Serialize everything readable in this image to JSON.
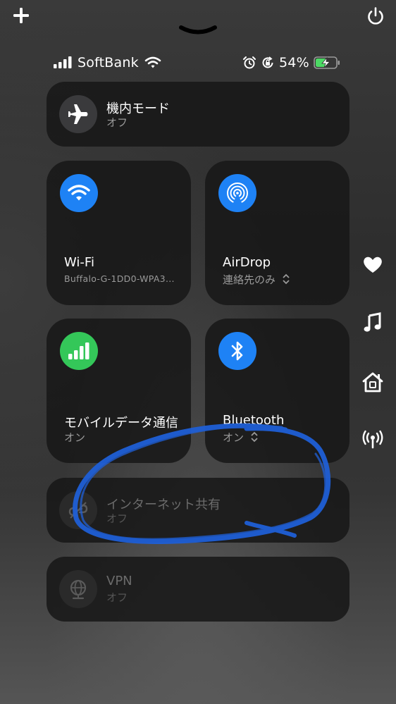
{
  "status_bar": {
    "carrier": "SoftBank",
    "battery_percent": "54%",
    "battery_level": 0.54
  },
  "tiles": {
    "airplane": {
      "title": "機内モード",
      "subtitle": "オフ"
    },
    "wifi": {
      "title": "Wi-Fi",
      "subtitle": "Buffalo-G-1DD0-WPA3..."
    },
    "airdrop": {
      "title": "AirDrop",
      "subtitle": "連絡先のみ"
    },
    "cellular": {
      "title": "モバイルデータ通信",
      "subtitle": "オン"
    },
    "bluetooth": {
      "title": "Bluetooth",
      "subtitle": "オン"
    },
    "hotspot": {
      "title": "インターネット共有",
      "subtitle": "オフ"
    },
    "vpn": {
      "title": "VPN",
      "subtitle": "オフ"
    }
  },
  "colors": {
    "accent_blue": "#1e82f5",
    "accent_green": "#34c759",
    "annotation_blue": "#1f5fd6",
    "battery_green": "#4cd964"
  }
}
